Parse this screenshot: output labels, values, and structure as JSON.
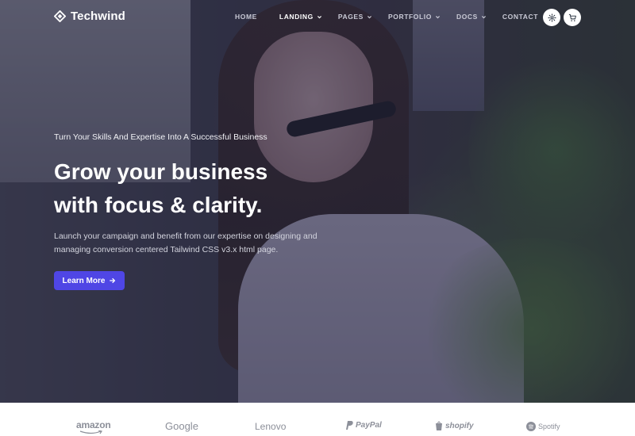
{
  "brand": {
    "name": "Techwind",
    "logo_icon": "techwind-logo-icon"
  },
  "nav": {
    "items": [
      {
        "label": "Home",
        "has_dropdown": false,
        "active": false
      },
      {
        "label": "Landing",
        "has_dropdown": true,
        "active": true
      },
      {
        "label": "Pages",
        "has_dropdown": true,
        "active": false
      },
      {
        "label": "Portfolio",
        "has_dropdown": true,
        "active": false
      },
      {
        "label": "Docs",
        "has_dropdown": true,
        "active": false
      },
      {
        "label": "Contact",
        "has_dropdown": false,
        "active": false
      }
    ],
    "settings_icon": "gear-icon",
    "cart_icon": "cart-icon"
  },
  "hero": {
    "eyebrow": "Turn Your Skills And Expertise Into A Successful Business",
    "headline_line1": "Grow your business",
    "headline_line2": "with focus & clarity.",
    "description_line1": "Launch your campaign and benefit from our expertise on designing and",
    "description_line2": "managing conversion centered Tailwind CSS v3.x html page.",
    "cta_label": "Learn More",
    "cta_icon": "arrow-right-icon"
  },
  "partners": {
    "logos": [
      "amazon",
      "Google",
      "Lenovo",
      "PayPal",
      "shopify",
      "Spotify"
    ]
  },
  "colors": {
    "accent": "#4f46e5",
    "logo_gray": "#8c8f99",
    "overlay": "#1e203c"
  }
}
